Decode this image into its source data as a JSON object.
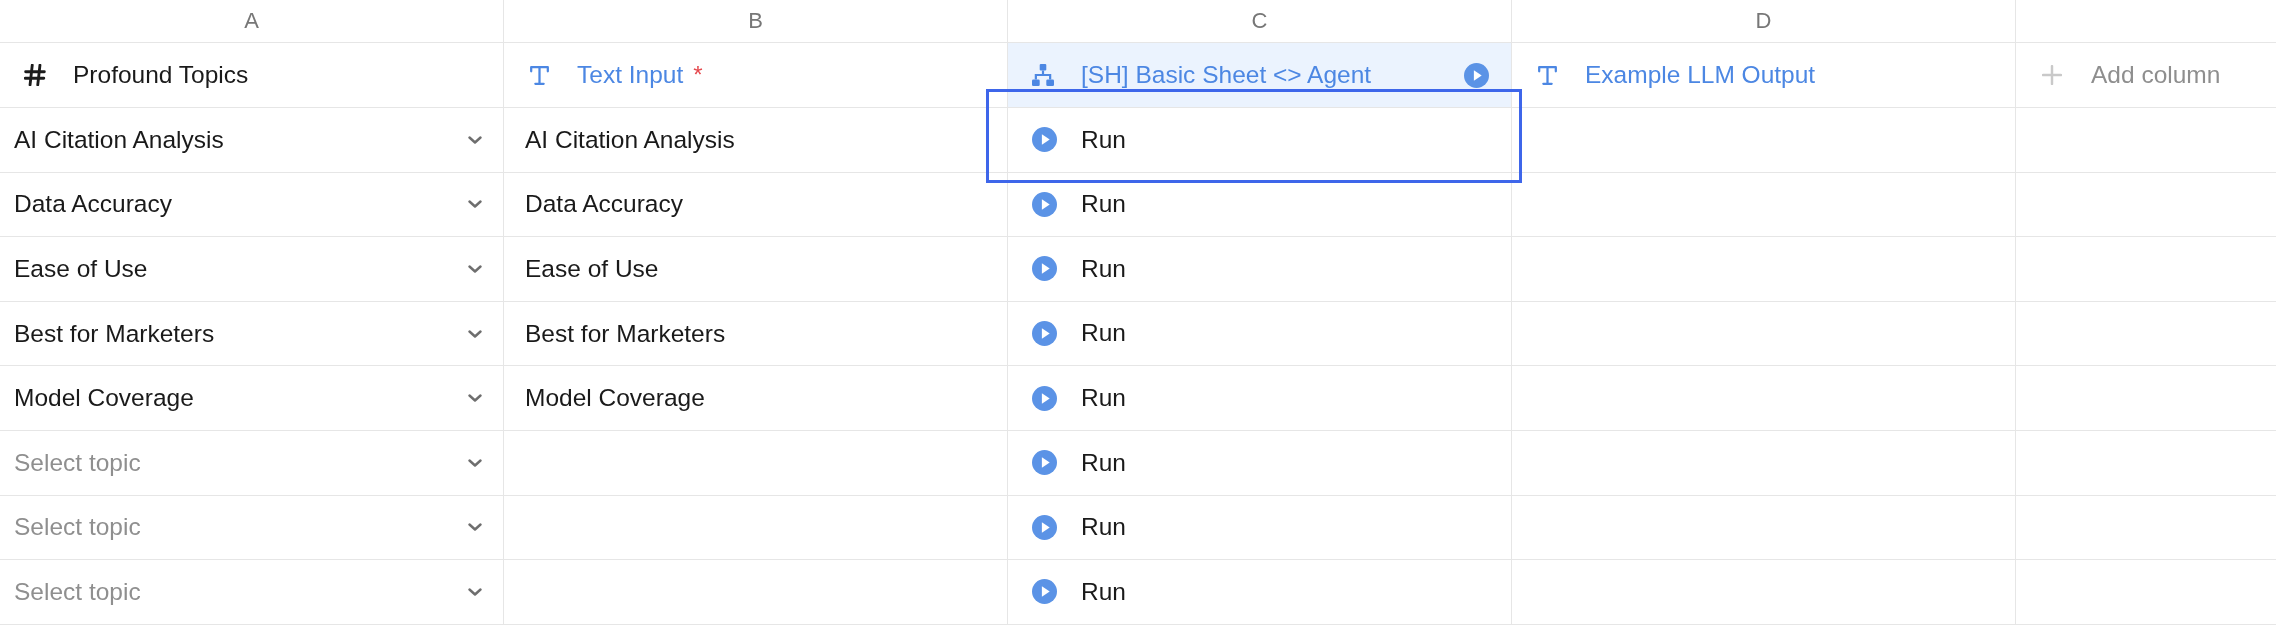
{
  "column_letters": [
    "A",
    "B",
    "C",
    "D"
  ],
  "columns": [
    {
      "kind": "number",
      "title": "Profound Topics",
      "selected": false
    },
    {
      "kind": "text",
      "title": "Text Input",
      "required_mark": "*",
      "selected": false
    },
    {
      "kind": "agent",
      "title": "[SH] Basic Sheet <> Agent",
      "selected": true
    },
    {
      "kind": "text",
      "title": "Example LLM Output",
      "selected": false
    }
  ],
  "add_column": {
    "label": "Add column"
  },
  "rows": [
    {
      "topic": {
        "value": "AI Citation Analysis"
      },
      "text_input": "AI Citation Analysis",
      "run": {
        "label": "Run",
        "selected": true
      }
    },
    {
      "topic": {
        "value": "Data Accuracy"
      },
      "text_input": "Data Accuracy",
      "run": {
        "label": "Run",
        "selected": false
      }
    },
    {
      "topic": {
        "value": "Ease of Use"
      },
      "text_input": "Ease of Use",
      "run": {
        "label": "Run",
        "selected": false
      }
    },
    {
      "topic": {
        "value": "Best for Marketers"
      },
      "text_input": "Best for Marketers",
      "run": {
        "label": "Run",
        "selected": false
      }
    },
    {
      "topic": {
        "value": "Model Coverage"
      },
      "text_input": "Model Coverage",
      "run": {
        "label": "Run",
        "selected": false
      }
    },
    {
      "topic": {
        "placeholder": "Select topic"
      },
      "run": {
        "label": "Run",
        "selected": false
      }
    },
    {
      "topic": {
        "placeholder": "Select topic"
      },
      "run": {
        "label": "Run",
        "selected": false
      }
    },
    {
      "topic": {
        "placeholder": "Select topic"
      },
      "run": {
        "label": "Run",
        "selected": false
      }
    }
  ]
}
